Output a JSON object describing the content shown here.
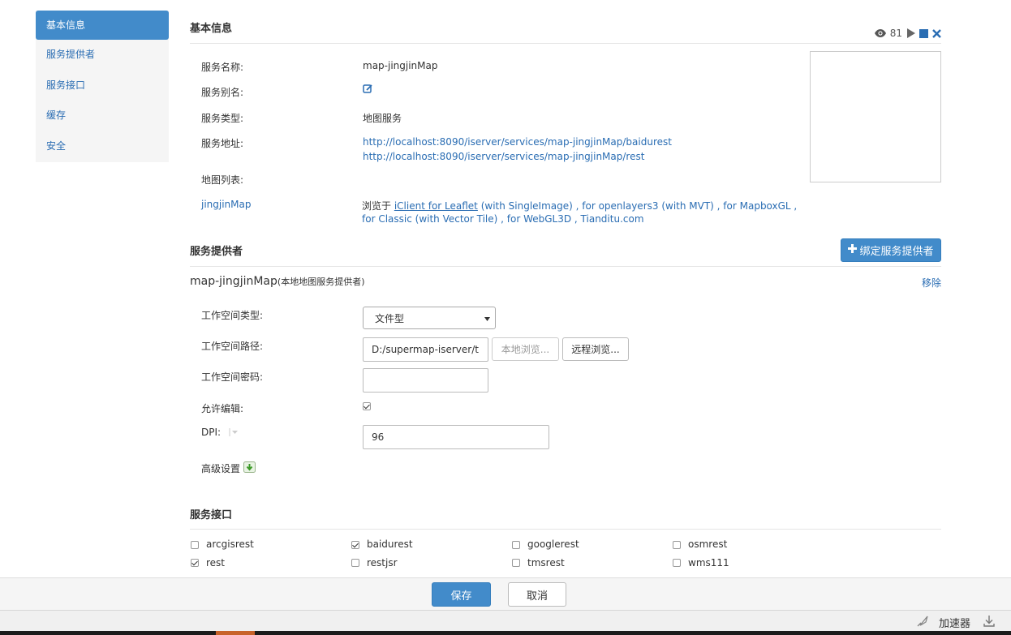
{
  "sidebar": {
    "items": [
      {
        "label": "基本信息",
        "active": true
      },
      {
        "label": "服务提供者",
        "active": false
      },
      {
        "label": "服务接口",
        "active": false
      },
      {
        "label": "缓存",
        "active": false
      },
      {
        "label": "安全",
        "active": false
      }
    ]
  },
  "basic_info": {
    "title": "基本信息",
    "view_count": "81",
    "service_name_label": "服务名称:",
    "service_name": "map-jingjinMap",
    "alias_label": "服务别名:",
    "type_label": "服务类型:",
    "type": "地图服务",
    "address_label": "服务地址:",
    "address_1": "http://localhost:8090/iserver/services/map-jingjinMap/baidurest",
    "address_2": "http://localhost:8090/iserver/services/map-jingjinMap/rest",
    "map_list_label": "地图列表:",
    "map_name": "jingjinMap",
    "browse_prefix": "浏览于 ",
    "browse_link_1": "iClient for Leaflet",
    "browse_line_1_rest": " (with SingleImage) , for openlayers3 (with MVT) , for MapboxGL ,",
    "browse_line_2": "for Classic (with Vector Tile) , for WebGL3D , Tianditu.com"
  },
  "provider": {
    "title": "服务提供者",
    "bind_button": "绑定服务提供者",
    "name": "map-jingjinMap",
    "name_suffix": "(本地地图服务提供者)",
    "remove_link": "移除",
    "workspace_type_label": "工作空间类型:",
    "workspace_type_value": "文件型",
    "workspace_path_label": "工作空间路径:",
    "workspace_path_value": "D:/supermap-iserver/t",
    "local_browse": "本地浏览...",
    "remote_browse": "远程浏览...",
    "workspace_password_label": "工作空间密码:",
    "workspace_password_value": "",
    "allow_edit_label": "允许编辑:",
    "allow_edit_checked": true,
    "dpi_label": "DPI:",
    "dpi_value": "96",
    "advanced_label": "高级设置"
  },
  "interfaces": {
    "title": "服务接口",
    "items": [
      {
        "label": "arcgisrest",
        "checked": false
      },
      {
        "label": "baidurest",
        "checked": true
      },
      {
        "label": "googlerest",
        "checked": false
      },
      {
        "label": "osmrest",
        "checked": false
      },
      {
        "label": "rest",
        "checked": true
      },
      {
        "label": "restjsr",
        "checked": false
      },
      {
        "label": "tmsrest",
        "checked": false
      },
      {
        "label": "wms111",
        "checked": false
      }
    ]
  },
  "footer": {
    "save": "保存",
    "cancel": "取消"
  },
  "statusbar": {
    "accelerator": "加速器"
  },
  "colors": {
    "primary": "#428bca",
    "link": "#2a6db3"
  }
}
